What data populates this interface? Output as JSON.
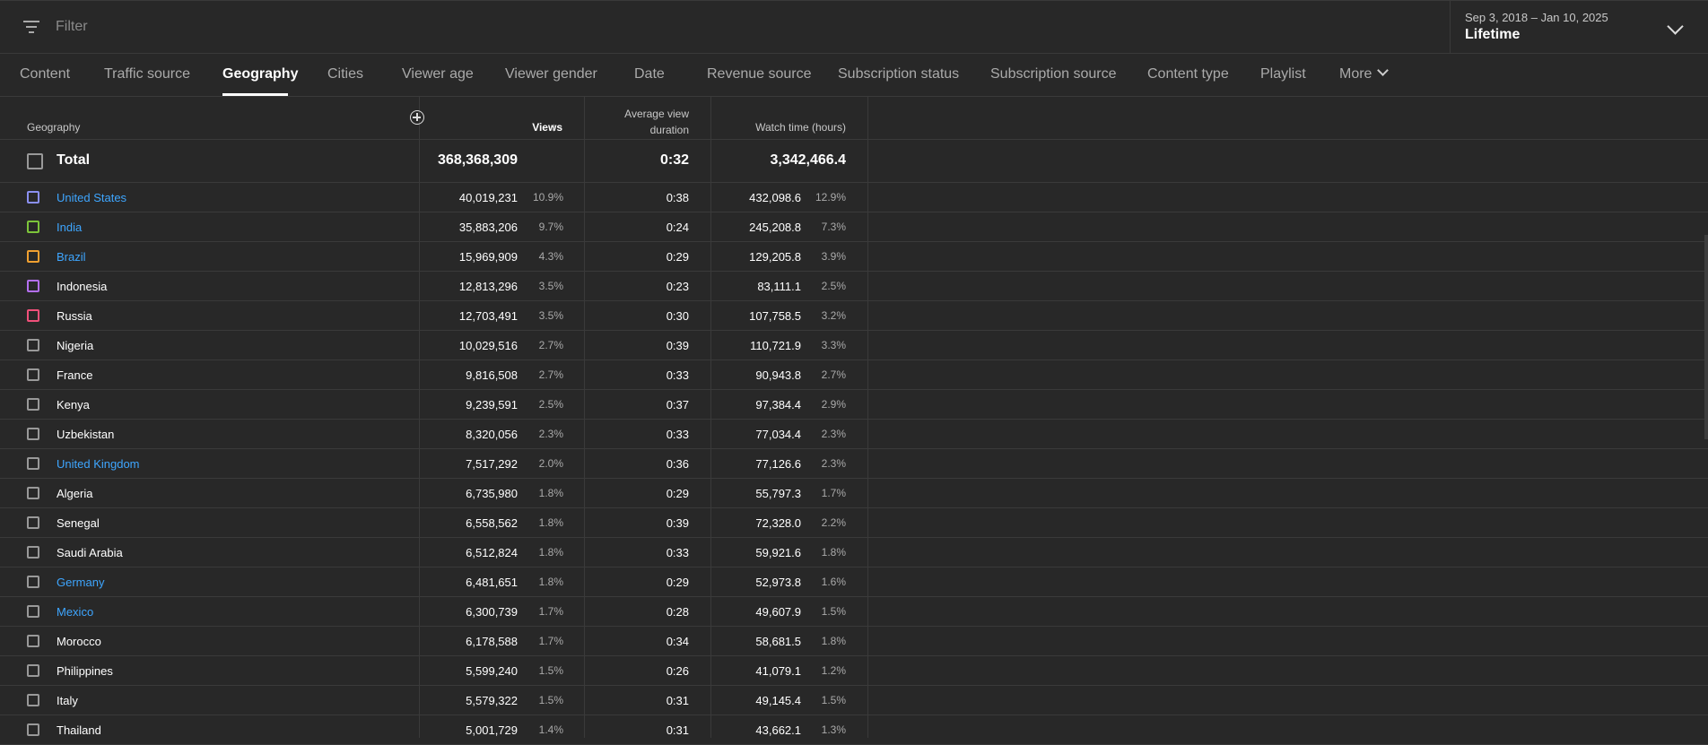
{
  "filter": {
    "placeholder": "Filter",
    "icon": "filter-icon"
  },
  "date": {
    "range": "Sep 3, 2018 – Jan 10, 2025",
    "label": "Lifetime"
  },
  "tabs": [
    "Content",
    "Traffic source",
    "Geography",
    "Cities",
    "Viewer age",
    "Viewer gender",
    "Date",
    "Revenue source",
    "Subscription status",
    "Subscription source",
    "Content type",
    "Playlist",
    "More"
  ],
  "active_tab": "Geography",
  "table": {
    "headers": {
      "geography": "Geography",
      "views": "Views",
      "avd_line1": "Average view",
      "avd_line2": "duration",
      "watch_time": "Watch time (hours)"
    },
    "total": {
      "name": "Total",
      "views": "368,368,309",
      "avd": "0:32",
      "watch_time": "3,342,466.4"
    },
    "rows": [
      {
        "name": "United States",
        "views": "40,019,231",
        "views_pct": "10.9%",
        "avd": "0:38",
        "watch_time": "432,098.6",
        "wt_pct": "12.9%",
        "link": true,
        "color": "#8a8ff0"
      },
      {
        "name": "India",
        "views": "35,883,206",
        "views_pct": "9.7%",
        "avd": "0:24",
        "watch_time": "245,208.8",
        "wt_pct": "7.3%",
        "link": true,
        "color": "#7cc43a"
      },
      {
        "name": "Brazil",
        "views": "15,969,909",
        "views_pct": "4.3%",
        "avd": "0:29",
        "watch_time": "129,205.8",
        "wt_pct": "3.9%",
        "link": true,
        "color": "#f0a030"
      },
      {
        "name": "Indonesia",
        "views": "12,813,296",
        "views_pct": "3.5%",
        "avd": "0:23",
        "watch_time": "83,111.1",
        "wt_pct": "2.5%",
        "link": false,
        "color": "#b36ff0"
      },
      {
        "name": "Russia",
        "views": "12,703,491",
        "views_pct": "3.5%",
        "avd": "0:30",
        "watch_time": "107,758.5",
        "wt_pct": "3.2%",
        "link": false,
        "color": "#f0507a"
      },
      {
        "name": "Nigeria",
        "views": "10,029,516",
        "views_pct": "2.7%",
        "avd": "0:39",
        "watch_time": "110,721.9",
        "wt_pct": "3.3%",
        "link": false,
        "color": ""
      },
      {
        "name": "France",
        "views": "9,816,508",
        "views_pct": "2.7%",
        "avd": "0:33",
        "watch_time": "90,943.8",
        "wt_pct": "2.7%",
        "link": false,
        "color": ""
      },
      {
        "name": "Kenya",
        "views": "9,239,591",
        "views_pct": "2.5%",
        "avd": "0:37",
        "watch_time": "97,384.4",
        "wt_pct": "2.9%",
        "link": false,
        "color": ""
      },
      {
        "name": "Uzbekistan",
        "views": "8,320,056",
        "views_pct": "2.3%",
        "avd": "0:33",
        "watch_time": "77,034.4",
        "wt_pct": "2.3%",
        "link": false,
        "color": ""
      },
      {
        "name": "United Kingdom",
        "views": "7,517,292",
        "views_pct": "2.0%",
        "avd": "0:36",
        "watch_time": "77,126.6",
        "wt_pct": "2.3%",
        "link": true,
        "color": ""
      },
      {
        "name": "Algeria",
        "views": "6,735,980",
        "views_pct": "1.8%",
        "avd": "0:29",
        "watch_time": "55,797.3",
        "wt_pct": "1.7%",
        "link": false,
        "color": ""
      },
      {
        "name": "Senegal",
        "views": "6,558,562",
        "views_pct": "1.8%",
        "avd": "0:39",
        "watch_time": "72,328.0",
        "wt_pct": "2.2%",
        "link": false,
        "color": ""
      },
      {
        "name": "Saudi Arabia",
        "views": "6,512,824",
        "views_pct": "1.8%",
        "avd": "0:33",
        "watch_time": "59,921.6",
        "wt_pct": "1.8%",
        "link": false,
        "color": ""
      },
      {
        "name": "Germany",
        "views": "6,481,651",
        "views_pct": "1.8%",
        "avd": "0:29",
        "watch_time": "52,973.8",
        "wt_pct": "1.6%",
        "link": true,
        "color": ""
      },
      {
        "name": "Mexico",
        "views": "6,300,739",
        "views_pct": "1.7%",
        "avd": "0:28",
        "watch_time": "49,607.9",
        "wt_pct": "1.5%",
        "link": true,
        "color": ""
      },
      {
        "name": "Morocco",
        "views": "6,178,588",
        "views_pct": "1.7%",
        "avd": "0:34",
        "watch_time": "58,681.5",
        "wt_pct": "1.8%",
        "link": false,
        "color": ""
      },
      {
        "name": "Philippines",
        "views": "5,599,240",
        "views_pct": "1.5%",
        "avd": "0:26",
        "watch_time": "41,079.1",
        "wt_pct": "1.2%",
        "link": false,
        "color": ""
      },
      {
        "name": "Italy",
        "views": "5,579,322",
        "views_pct": "1.5%",
        "avd": "0:31",
        "watch_time": "49,145.4",
        "wt_pct": "1.5%",
        "link": false,
        "color": ""
      },
      {
        "name": "Thailand",
        "views": "5,001,729",
        "views_pct": "1.4%",
        "avd": "0:31",
        "watch_time": "43,662.1",
        "wt_pct": "1.3%",
        "link": false,
        "color": ""
      }
    ]
  }
}
